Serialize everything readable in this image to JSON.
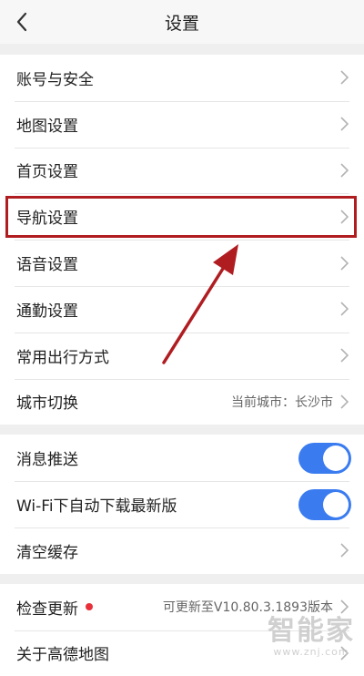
{
  "header": {
    "title": "设置"
  },
  "groups": [
    {
      "items": [
        {
          "label": "账号与安全"
        },
        {
          "label": "地图设置"
        },
        {
          "label": "首页设置"
        },
        {
          "label": "导航设置"
        },
        {
          "label": "语音设置"
        },
        {
          "label": "通勤设置"
        },
        {
          "label": "常用出行方式"
        },
        {
          "label": "城市切换",
          "value": "当前城市：长沙市"
        }
      ]
    },
    {
      "items": [
        {
          "label": "消息推送",
          "toggle": true
        },
        {
          "label": "Wi-Fi下自动下载最新版",
          "toggle": true
        },
        {
          "label": "清空缓存"
        }
      ]
    },
    {
      "items": [
        {
          "label": "检查更新",
          "value": "可更新至V10.80.3.1893版本"
        },
        {
          "label": "关于高德地图"
        }
      ]
    }
  ],
  "watermark": {
    "main": "智能家",
    "sub": "www.znj.com"
  },
  "colors": {
    "accent_blue": "#3a7cf0",
    "highlight_red": "#b01d21",
    "badge_red": "#e8303a",
    "chevron_gray": "#b3b3b3"
  },
  "icons": {
    "back": "chevron-left-icon",
    "row": "chevron-right-icon"
  }
}
